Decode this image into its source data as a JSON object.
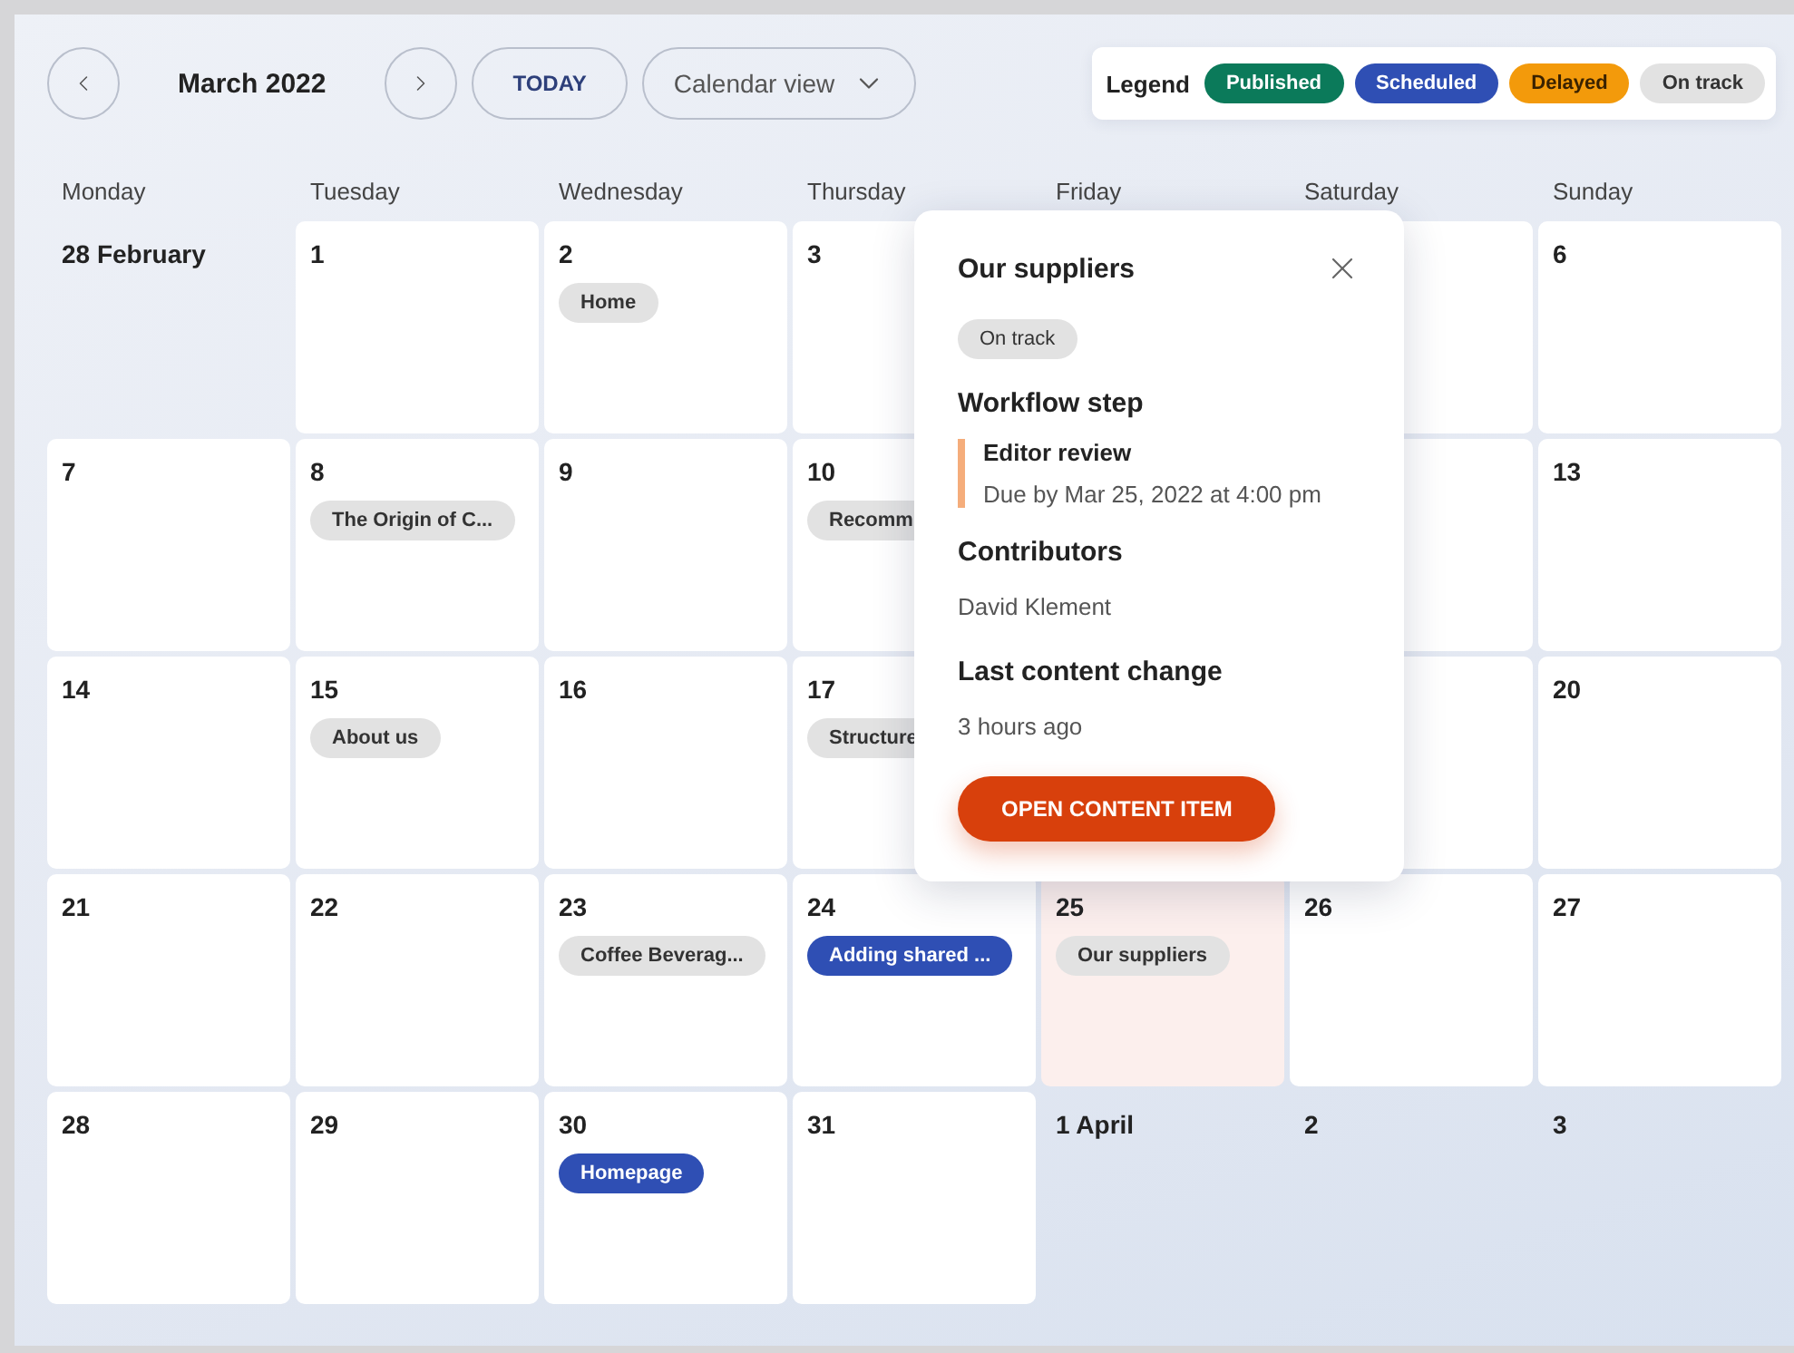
{
  "toolbar": {
    "month": "March 2022",
    "today": "TODAY",
    "view": "Calendar view"
  },
  "legend": {
    "label": "Legend",
    "items": [
      {
        "label": "Published",
        "color": "#0b7a5a"
      },
      {
        "label": "Scheduled",
        "color": "#2f4fb4"
      },
      {
        "label": "Delayed",
        "color": "#f39a0b"
      },
      {
        "label": "On track",
        "color": "#e2e2e2"
      }
    ]
  },
  "weekdays": [
    "Monday",
    "Tuesday",
    "Wednesday",
    "Thursday",
    "Friday",
    "Saturday",
    "Sunday"
  ],
  "weeks": [
    {
      "covered": true,
      "days": [
        {
          "date": "28 February",
          "in_month": false,
          "selected": false
        },
        {
          "date": "1",
          "in_month": true,
          "selected": false
        },
        {
          "date": "2",
          "in_month": true,
          "selected": false,
          "items": [
            {
              "label": "Home",
              "color": "#e2e2e2"
            }
          ]
        },
        {
          "date": "3",
          "in_month": true,
          "selected": false
        },
        {
          "in_month": true,
          "selected": false
        },
        {
          "date": "6",
          "in_month": true,
          "selected": false
        }
      ]
    },
    {
      "covered": true,
      "days": [
        {
          "date": "7",
          "in_month": true,
          "selected": false
        },
        {
          "date": "8",
          "in_month": true,
          "selected": false,
          "items": [
            {
              "label": "The Origin of C...",
              "color": "#e2e2e2"
            }
          ]
        },
        {
          "date": "9",
          "in_month": true,
          "selected": false
        },
        {
          "date": "10",
          "in_month": true,
          "selected": false,
          "items": [
            {
              "label": "Recomm",
              "color": "#e2e2e2"
            }
          ]
        },
        {
          "in_month": true,
          "selected": false
        },
        {
          "date": "13",
          "in_month": true,
          "selected": false
        }
      ]
    },
    {
      "covered": true,
      "days": [
        {
          "date": "14",
          "in_month": true,
          "selected": false
        },
        {
          "date": "15",
          "in_month": true,
          "selected": false,
          "items": [
            {
              "label": "About us",
              "color": "#e2e2e2"
            }
          ]
        },
        {
          "date": "16",
          "in_month": true,
          "selected": false
        },
        {
          "date": "17",
          "in_month": true,
          "selected": false,
          "items": [
            {
              "label": "Structure",
              "color": "#e2e2e2"
            }
          ]
        },
        {
          "in_month": true,
          "selected": false
        },
        {
          "date": "20",
          "in_month": true,
          "selected": false
        }
      ]
    },
    {
      "covered": false,
      "days": [
        {
          "date": "21",
          "in_month": true,
          "selected": false
        },
        {
          "date": "22",
          "in_month": true,
          "selected": false
        },
        {
          "date": "23",
          "in_month": true,
          "selected": false,
          "items": [
            {
              "label": "Coffee Beverag...",
              "color": "#e2e2e2"
            }
          ]
        },
        {
          "date": "24",
          "in_month": true,
          "selected": false,
          "items": [
            {
              "label": "Adding shared ...",
              "color": "#2f4fb4"
            }
          ]
        },
        {
          "date": "25",
          "in_month": true,
          "selected": true,
          "items": [
            {
              "label": "Our suppliers",
              "color": "#e2e2e2"
            }
          ]
        },
        {
          "date": "26",
          "in_month": true,
          "selected": false
        },
        {
          "date": "27",
          "in_month": true,
          "selected": false
        }
      ]
    },
    {
      "covered": false,
      "days": [
        {
          "date": "28",
          "in_month": true,
          "selected": false
        },
        {
          "date": "29",
          "in_month": true,
          "selected": false
        },
        {
          "date": "30",
          "in_month": true,
          "selected": false,
          "items": [
            {
              "label": "Homepage",
              "color": "#2f4fb4"
            }
          ]
        },
        {
          "date": "31",
          "in_month": true,
          "selected": false
        },
        {
          "date": "1 April",
          "in_month": false,
          "selected": false
        },
        {
          "date": "2",
          "in_month": false,
          "selected": false
        },
        {
          "date": "3",
          "in_month": false,
          "selected": false
        }
      ]
    }
  ],
  "popover": {
    "title": "Our suppliers",
    "status": {
      "label": "On track",
      "color": "#e2e2e2"
    },
    "workflow_heading": "Workflow step",
    "step": "Editor review",
    "due": "Due by Mar 25, 2022 at 4:00 pm",
    "contributors_heading": "Contributors",
    "contributor": "David Klement",
    "change_heading": "Last content change",
    "change": "3 hours ago",
    "button": "OPEN CONTENT ITEM"
  }
}
